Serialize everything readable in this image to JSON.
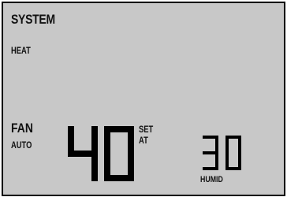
{
  "display": {
    "system_label": "SYSTEM",
    "system_mode": "HEAT",
    "fan_label": "FAN",
    "fan_mode": "AUTO",
    "set_label": "SET",
    "at_label": "AT",
    "humid_label": "HUMID",
    "setpoint": "40",
    "humidity": "30"
  },
  "colors": {
    "lcd_background": "#c8c8c8",
    "segment": "#000000",
    "border": "#000000"
  }
}
